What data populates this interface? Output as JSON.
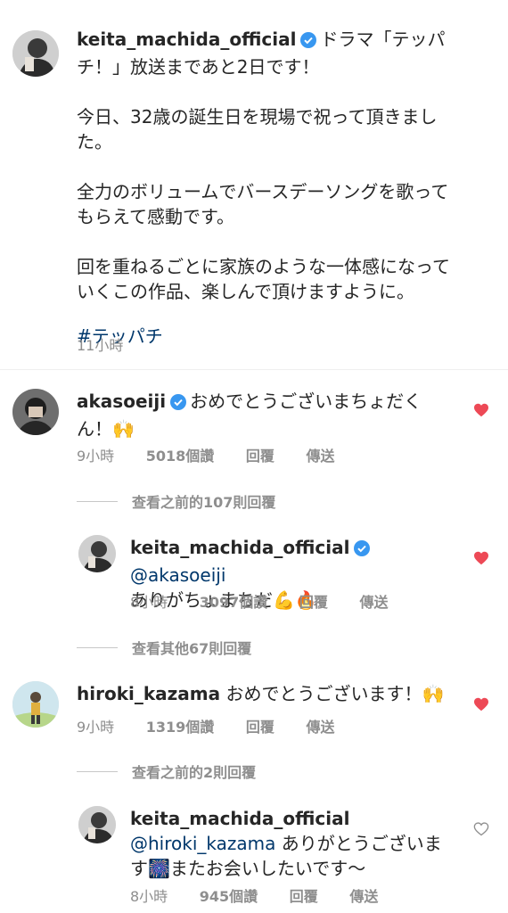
{
  "post": {
    "username": "keita_machida_official",
    "text_line1": "ドラマ「テッパ",
    "text_line2": "チ！」放送まであと2日です！",
    "para2_line1": "今日、32歳の誕生日を現場で祝って頂きまし",
    "para2_line2": "た。",
    "para3_line1": "全力のボリュームでバースデーソングを歌って",
    "para3_line2": "もらえて感動です。",
    "para4_line1": "回を重ねるごとに家族のような一体感になって",
    "para4_line2": "いくこの作品、楽しんで頂けますように。",
    "hashtag": "#テッパチ",
    "time": "11小時"
  },
  "comments": [
    {
      "username": "akasoeiji",
      "text_line1": "おめでとうございまちょだく",
      "text_line2": "ん！🙌",
      "time": "9小時",
      "likes": "5018個讚",
      "reply": "回覆",
      "send": "傳送",
      "view_replies": "查看之前的107則回覆",
      "reply_item": {
        "username": "keita_machida_official",
        "mention": "@akasoeiji",
        "text": "ありがちょまちだ💪🔥",
        "time": "8小時",
        "likes": "3097個讚",
        "reply": "回覆",
        "send": "傳送"
      },
      "view_more": "查看其他67則回覆"
    },
    {
      "username": "hiroki_kazama",
      "text": "おめでとうございます！🙌",
      "time": "9小時",
      "likes": "1319個讚",
      "reply": "回覆",
      "send": "傳送",
      "view_replies": "查看之前的2則回覆",
      "reply_item": {
        "username": "keita_machida_official",
        "mention": "@hiroki_kazama",
        "text_line1": "ありがとうございま",
        "text_line2": "す🎆またお会いしたいです〜",
        "time": "8小時",
        "likes": "945個讚",
        "reply": "回覆",
        "send": "傳送"
      }
    }
  ],
  "colors": {
    "like_red": "#ed4956",
    "link_blue": "#00376b",
    "verified_blue": "#3897f0",
    "meta_gray": "#8e8e8e"
  }
}
